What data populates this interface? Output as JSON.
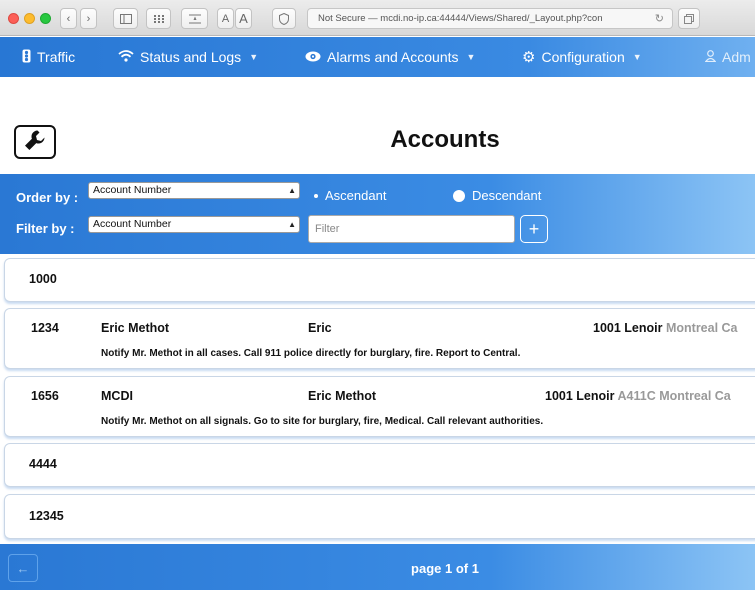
{
  "browser": {
    "address": "Not Secure — mcdi.no-ip.ca:44444/Views/Shared/_Layout.php?con",
    "text_size_small": "A",
    "text_size_large": "A"
  },
  "nav": {
    "traffic": "Traffic",
    "status_logs": "Status and Logs",
    "alarms_accounts": "Alarms and Accounts",
    "configuration": "Configuration",
    "admin": "Adm"
  },
  "page": {
    "title": "Accounts"
  },
  "filters": {
    "order_by_label": "Order by :",
    "order_by_value": "Account Number",
    "filter_by_label": "Filter by :",
    "filter_by_value": "Account Number",
    "ascendant": "Ascendant",
    "descendant": "Descendant",
    "filter_placeholder": "Filter",
    "add_symbol": "+"
  },
  "accounts": [
    {
      "number": "1000"
    },
    {
      "number": "1234",
      "name": "Eric Methot",
      "contact": "Eric",
      "address": "1001 Lenoir",
      "address_extra": "",
      "city": "Montreal Ca",
      "note": "Notify Mr. Methot in all cases. Call 911 police directly for burglary, fire. Report to Central."
    },
    {
      "number": "1656",
      "name": "MCDI",
      "contact": "Eric Methot",
      "address": "1001 Lenoir",
      "address_extra": "A411C",
      "city": "Montreal Ca",
      "note": "Notify Mr. Methot on all signals. Go to site for burglary, fire, Medical. Call relevant authorities."
    },
    {
      "number": "4444"
    },
    {
      "number": "12345"
    }
  ],
  "footer": {
    "page_indicator": "page 1 of 1",
    "prev_symbol": "←"
  },
  "colors": {
    "primary_blue": "#2a78d4",
    "light_blue": "#8cc4f5"
  }
}
